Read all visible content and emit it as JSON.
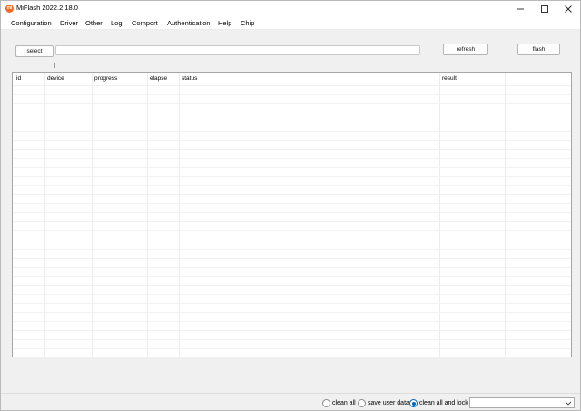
{
  "window": {
    "title": "MiFlash 2022.2.18.0",
    "app_icon_glyph": "mi"
  },
  "menu": {
    "items": [
      "Configuration",
      "Driver",
      "Other",
      "Log",
      "Comport",
      "Authentication",
      "Help",
      "Chip"
    ]
  },
  "toolbar": {
    "select_label": "select",
    "path_value": "",
    "refresh_label": "refresh",
    "flash_label": "flash"
  },
  "table": {
    "columns": [
      "id",
      "device",
      "progress",
      "elapse",
      "status",
      "result"
    ],
    "rows": []
  },
  "footer": {
    "options": [
      {
        "label": "clean all",
        "checked": false
      },
      {
        "label": "save user data",
        "checked": false
      },
      {
        "label": "clean all and lock",
        "checked": true
      }
    ],
    "dropdown_value": ""
  },
  "colors": {
    "app_icon": "#f26c23",
    "radio_selected": "#0067c0"
  }
}
